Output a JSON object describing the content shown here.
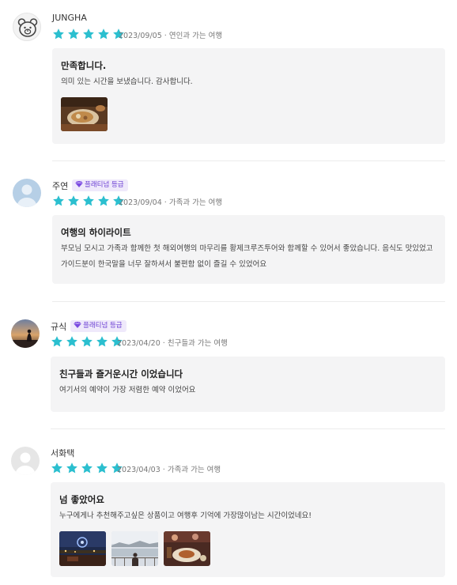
{
  "reviews": [
    {
      "name": "JUNGHA",
      "badge": "",
      "rating": 5,
      "date": "2023/09/05",
      "trip_type": "연인과 가는 여행",
      "title": "만족합니다.",
      "body": "의미 있는 시간을 보냈습니다. 감사합니다.",
      "photo_count": 1,
      "avatar_icon": "bear-icon"
    },
    {
      "name": "주연",
      "badge": "플래티넘 등급",
      "rating": 5,
      "date": "2023/09/04",
      "trip_type": "가족과 가는 여행",
      "title": "여행의 하이라이트",
      "body": "부모님 모시고 가족과 함께한 첫 해외여행의 마무리를 황제크루즈투어와 함께할 수 있어서 좋았습니다. 음식도 맛있었고 가이드분이 한국말을 너무 잘하셔서 불편함 없이 즐길 수 있었어요",
      "photo_count": 0,
      "avatar_icon": "default-user-icon"
    },
    {
      "name": "규식",
      "badge": "플래티넘 등급",
      "rating": 5,
      "date": "2023/04/20",
      "trip_type": "친구들과 가는 여행",
      "title": "친구들과 즐거운시간 이었습니다",
      "body": "여기서의 예약이 가장 저렴한 예약 이었어요",
      "photo_count": 0,
      "avatar_icon": "sunset-photo"
    },
    {
      "name": "서화택",
      "badge": "",
      "rating": 5,
      "date": "2023/04/03",
      "trip_type": "가족과 가는 여행",
      "title": "넘 좋았어요",
      "body": "누구에게나 추천해주고싶은 상품이고 여행후 기억에 가장많이남는 시간이었네요!",
      "photo_count": 3,
      "avatar_icon": "default-user-icon"
    }
  ],
  "colors": {
    "star": "#2bbfcf",
    "badge_bg": "#efe9fb",
    "badge_text": "#6b3fd3",
    "card_bg": "#f4f4f5"
  }
}
